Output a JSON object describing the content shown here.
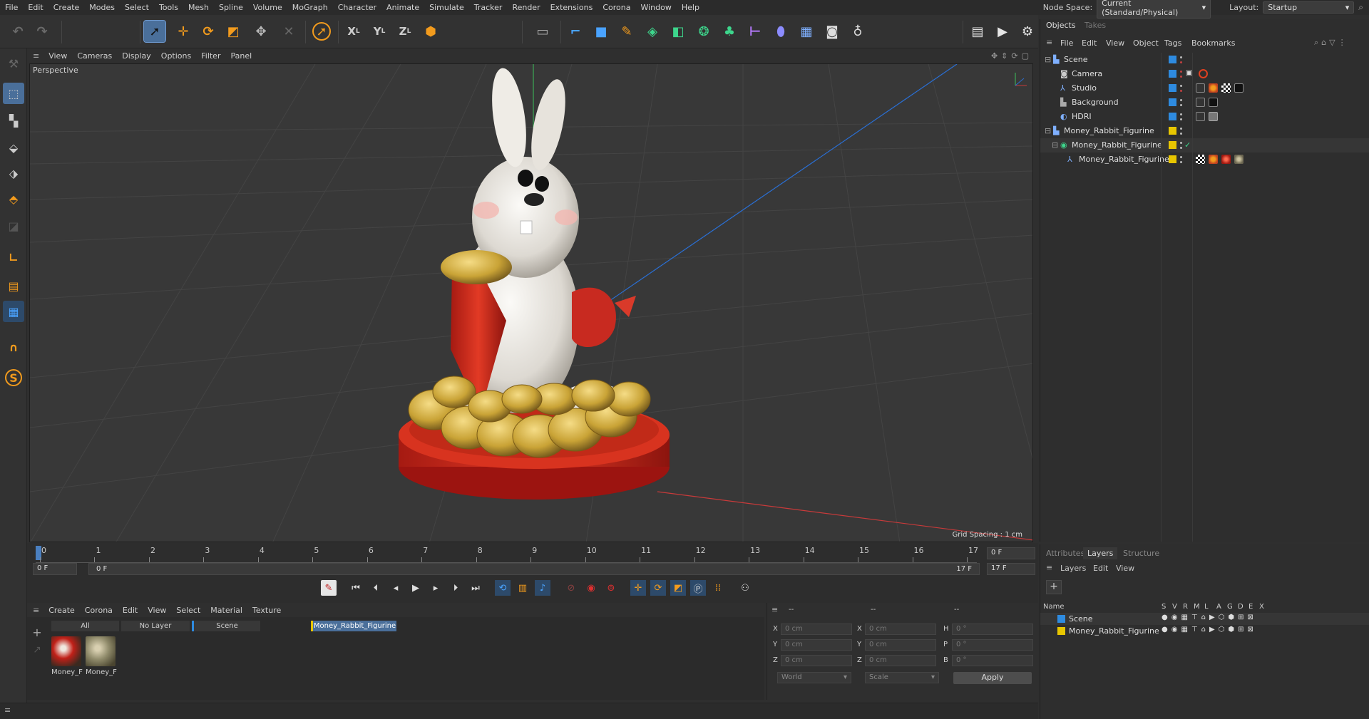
{
  "menubar": {
    "items": [
      "File",
      "Edit",
      "Create",
      "Modes",
      "Select",
      "Tools",
      "Mesh",
      "Spline",
      "Volume",
      "MoGraph",
      "Character",
      "Animate",
      "Simulate",
      "Tracker",
      "Render",
      "Extensions",
      "Corona",
      "Window",
      "Help"
    ],
    "node_space_label": "Node Space:",
    "node_space_value": "Current (Standard/Physical)",
    "layout_label": "Layout:",
    "layout_value": "Startup"
  },
  "toolbar": {
    "icons": [
      "undo-icon",
      "redo-icon",
      "select-cursor-icon",
      "move-icon",
      "rotate-icon",
      "scale-icon",
      "transform-icon",
      "cross-icon",
      "live-select-icon",
      "x-axis-icon",
      "y-axis-icon",
      "z-axis-icon",
      "coordinate-system-icon",
      "render-region-icon",
      "spline-pen-icon",
      "cube-icon",
      "sketch-icon",
      "subdivision-icon",
      "extrude-icon",
      "cloner-icon",
      "mograph-icon",
      "deformer-icon",
      "field-icon",
      "floor-icon",
      "camera-icon",
      "light-icon",
      "clapper-icon",
      "render-view-icon",
      "render-settings-icon"
    ]
  },
  "viewport": {
    "menu": [
      "View",
      "Cameras",
      "Display",
      "Options",
      "Filter",
      "Panel"
    ],
    "label": "Perspective",
    "grid_spacing": "Grid Spacing : 1 cm"
  },
  "timeline": {
    "ticks": [
      "0",
      "1",
      "2",
      "3",
      "4",
      "5",
      "6",
      "7",
      "8",
      "9",
      "10",
      "11",
      "12",
      "13",
      "14",
      "15",
      "16",
      "17"
    ],
    "current_frame": "0 F",
    "start_frame": "0 F",
    "range_start": "0 F",
    "range_end": "17 F",
    "end_frame": "17 F"
  },
  "materials": {
    "menu": [
      "Create",
      "Corona",
      "Edit",
      "View",
      "Select",
      "Material",
      "Texture"
    ],
    "layer_tabs": [
      "All",
      "No Layer",
      "Scene",
      "Money_Rabbit_Figurine"
    ],
    "items": [
      {
        "name": "Money_F"
      },
      {
        "name": "Money_F"
      }
    ]
  },
  "coords": {
    "headers": [
      "--",
      "--",
      "--"
    ],
    "rows": [
      {
        "a": "X",
        "av": "0 cm",
        "b": "X",
        "bv": "0 cm",
        "c": "H",
        "cv": "0 °"
      },
      {
        "a": "Y",
        "av": "0 cm",
        "b": "Y",
        "bv": "0 cm",
        "c": "P",
        "cv": "0 °"
      },
      {
        "a": "Z",
        "av": "0 cm",
        "b": "Z",
        "bv": "0 cm",
        "c": "B",
        "cv": "0 °"
      }
    ],
    "mode": "World",
    "transform": "Scale",
    "apply": "Apply"
  },
  "objects": {
    "tabs": [
      "Objects",
      "Takes"
    ],
    "menu": [
      "File",
      "Edit",
      "View",
      "Object",
      "Tags",
      "Bookmarks"
    ],
    "rows": [
      {
        "name": "Scene",
        "color": "#2e8be0"
      },
      {
        "name": "Camera",
        "color": "#2e8be0"
      },
      {
        "name": "Studio",
        "color": "#2e8be0"
      },
      {
        "name": "Background",
        "color": "#2e8be0"
      },
      {
        "name": "HDRI",
        "color": "#2e8be0"
      },
      {
        "name": "Money_Rabbit_Figurine",
        "color": "#e8c600"
      },
      {
        "name": "Money_Rabbit_Figurine",
        "color": "#e8c600"
      },
      {
        "name": "Money_Rabbit_Figurine",
        "color": "#e8c600"
      }
    ]
  },
  "layers": {
    "tabs": [
      "Attributes",
      "Layers",
      "Structure"
    ],
    "menu": [
      "Layers",
      "Edit",
      "View"
    ],
    "name_header": "Name",
    "col_headers": [
      "S",
      "V",
      "R",
      "M",
      "L",
      "A",
      "G",
      "D",
      "E",
      "X"
    ],
    "rows": [
      {
        "name": "Scene",
        "color": "#2e8be0"
      },
      {
        "name": "Money_Rabbit_Figurine",
        "color": "#e8c600"
      }
    ]
  }
}
